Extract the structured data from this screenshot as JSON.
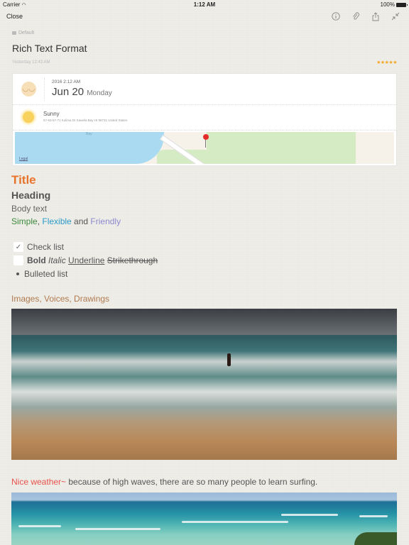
{
  "status_bar": {
    "carrier": "Carrier",
    "time": "1:12 AM",
    "battery": "100%"
  },
  "nav": {
    "close_label": "Close",
    "icons": [
      "info-icon",
      "attachment-icon",
      "share-icon",
      "collapse-icon"
    ]
  },
  "note": {
    "folder": "Default",
    "title": "Rich Text Format",
    "modified": "Yesterday 12:43 AM",
    "stars": "★★★★★",
    "rating": 5
  },
  "card": {
    "mood_icon": "smiley-icon",
    "year_time": "2016  2:12 AM",
    "date": "Jun 20",
    "day_of_week": "Monday",
    "weather": "Sunny",
    "address": "57-63-57-71 Kulima Dr Kawela Bay HI 96731 United States",
    "map": {
      "water_label": "Bay",
      "legal_label": "Legal"
    }
  },
  "content": {
    "title": "Title",
    "heading": "Heading",
    "body": "Body text",
    "colored": {
      "simple": "Simple",
      "comma": ", ",
      "flexible": "Flexible",
      "and": " and ",
      "friendly": "Friendly"
    },
    "checklist": [
      {
        "label": "Check list",
        "checked": true
      },
      {
        "bold": "Bold",
        "italic": "Italic",
        "underline": "Underline",
        "strike": "Strikethrough",
        "checked": false
      }
    ],
    "bulleted": "Bulleted list",
    "section_label": "Images, Voices, Drawings",
    "caption_highlight": "Nice weather~",
    "caption_rest": " because of high waves, there are so many people to learn surfing."
  },
  "colors": {
    "title": "#e8742c",
    "simple": "#3c8a3c",
    "flexible": "#2a9ac8",
    "friendly": "#8c8ad0",
    "section": "#b07a50",
    "highlight": "#e8524a",
    "stars": "#f4a623"
  }
}
